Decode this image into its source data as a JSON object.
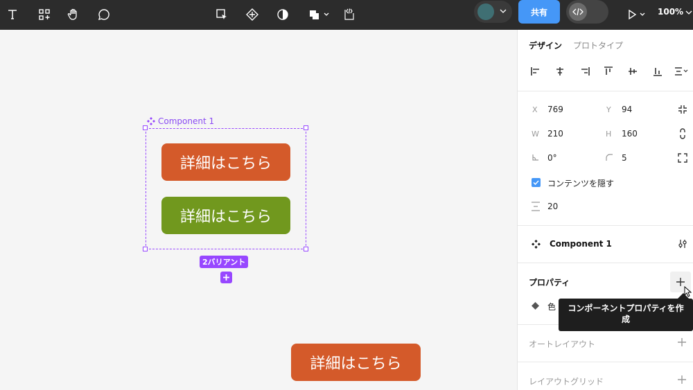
{
  "toolbar": {
    "share_label": "共有",
    "zoom_label": "100%"
  },
  "canvas": {
    "component_label": "Component 1",
    "button_top_text": "詳細はこちら",
    "button_bottom_text": "詳細はこちら",
    "button_loose_text": "詳細はこちら",
    "variant_badge": "2バリアント",
    "colors": {
      "orange": "#d45a2a",
      "green": "#71981e",
      "selection": "#9747ff"
    }
  },
  "panel": {
    "tab_design": "デザイン",
    "tab_prototype": "プロトタイプ",
    "x_label": "X",
    "x_value": "769",
    "y_label": "Y",
    "y_value": "94",
    "w_label": "W",
    "w_value": "210",
    "h_label": "H",
    "h_value": "160",
    "rotation_value": "0°",
    "radius_value": "5",
    "clip_content_label": "コンテンツを隠す",
    "spacing_value": "20",
    "component_name": "Component 1",
    "properties_title": "プロパティ",
    "property_item": "色",
    "auto_layout_title": "オートレイアウト",
    "layout_grid_title": "レイアウトグリッド"
  },
  "tooltip": {
    "line1": "コンポーネントプロパティを作",
    "line2": "成"
  }
}
